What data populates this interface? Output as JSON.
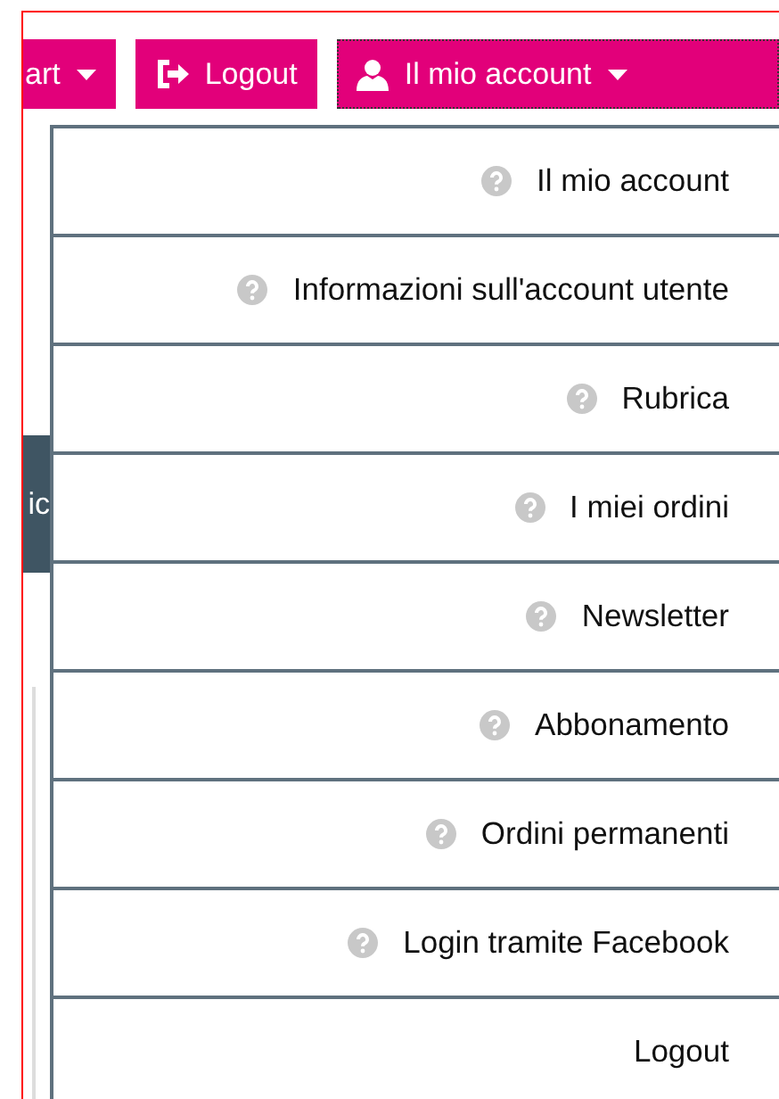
{
  "top_buttons": [
    {
      "kind": "dropdown",
      "label": "art",
      "focused": false
    },
    {
      "kind": "logout",
      "label": "Logout",
      "focused": false
    },
    {
      "kind": "account",
      "label": "Il mio account",
      "focused": true
    }
  ],
  "side_tab": {
    "label": "ic"
  },
  "menu": [
    {
      "kind": "help",
      "label": "Il mio account"
    },
    {
      "kind": "help",
      "label": "Informazioni sull'account utente"
    },
    {
      "kind": "help",
      "label": "Rubrica"
    },
    {
      "kind": "help",
      "label": "I miei ordini"
    },
    {
      "kind": "help",
      "label": "Newsletter"
    },
    {
      "kind": "help",
      "label": "Abbonamento"
    },
    {
      "kind": "help",
      "label": "Ordini permanenti"
    },
    {
      "kind": "help",
      "label": "Login tramite Facebook"
    },
    {
      "kind": "plain",
      "label": "Logout"
    }
  ]
}
